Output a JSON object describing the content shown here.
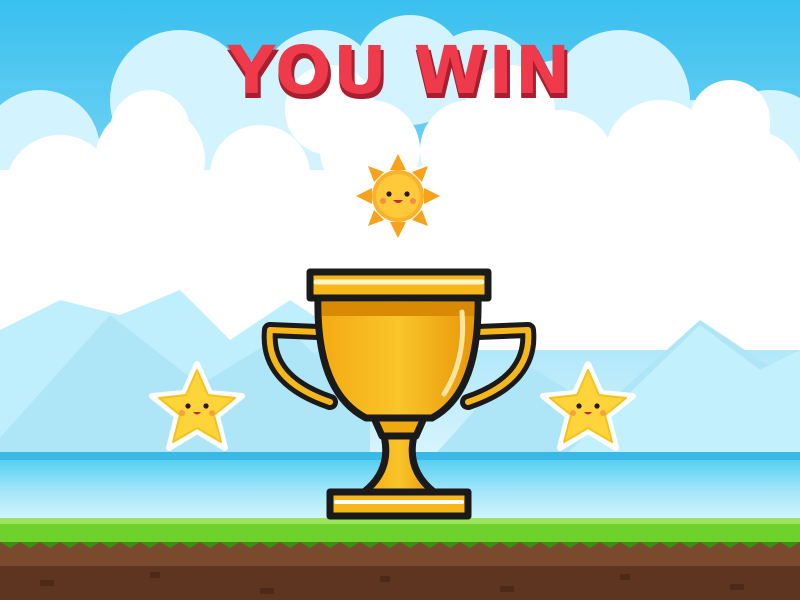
{
  "screen": {
    "title": "YOU WIN"
  },
  "colors": {
    "sky_top": "#39c0ee",
    "sky_bottom": "#b9ecfb",
    "cloud": "#ffffff",
    "cloud_shadow": "#c9f1fd",
    "sea": "#36c4ee",
    "grass": "#6ccf2a",
    "grass_dark": "#3c8f15",
    "dirt": "#7a4a2e",
    "dirt_dark": "#4d2a18",
    "trophy_gold": "#f6b71b",
    "trophy_outline": "#1a1a1a",
    "title_red": "#ef3a4c",
    "star_yellow": "#ffd43b",
    "sun_orange": "#f59a1b"
  },
  "decorations": {
    "trophy": "trophy-icon",
    "sun": "sun-icon",
    "stars": [
      "star-icon",
      "star-icon"
    ]
  }
}
